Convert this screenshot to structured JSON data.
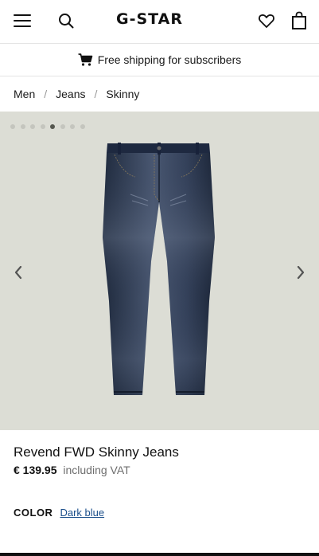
{
  "header": {
    "logo": "G-STAR",
    "menu_icon": "hamburger-menu-icon",
    "search_icon": "search-icon",
    "wishlist_icon": "heart-icon",
    "bag_icon": "shopping-bag-icon"
  },
  "promo": {
    "icon": "shopping-cart-icon",
    "text": "Free shipping for subscribers"
  },
  "breadcrumb": {
    "items": [
      "Men",
      "Jeans",
      "Skinny"
    ],
    "separator": "/"
  },
  "gallery": {
    "image_count": 8,
    "active_index": 4,
    "prev_icon": "chevron-left-icon",
    "next_icon": "chevron-right-icon",
    "background": "#dcddd5",
    "image": "dark-blue-skinny-jeans"
  },
  "product": {
    "name": "Revend FWD Skinny Jeans",
    "price": "€ 139.95",
    "vat_note": "including VAT"
  },
  "color": {
    "label": "COLOR",
    "value": "Dark blue"
  },
  "colors": {
    "link": "#1a4e8a",
    "denim": "#27344a"
  }
}
